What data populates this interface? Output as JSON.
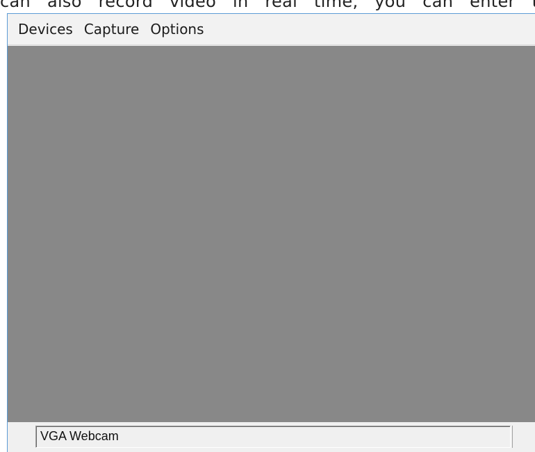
{
  "background_text": "can also record video in real time, you can enter the",
  "menubar": {
    "items": [
      {
        "label": "Devices"
      },
      {
        "label": "Capture"
      },
      {
        "label": "Options"
      }
    ]
  },
  "preview": {
    "color": "#888888"
  },
  "statusbar": {
    "device_name": "VGA Webcam"
  }
}
